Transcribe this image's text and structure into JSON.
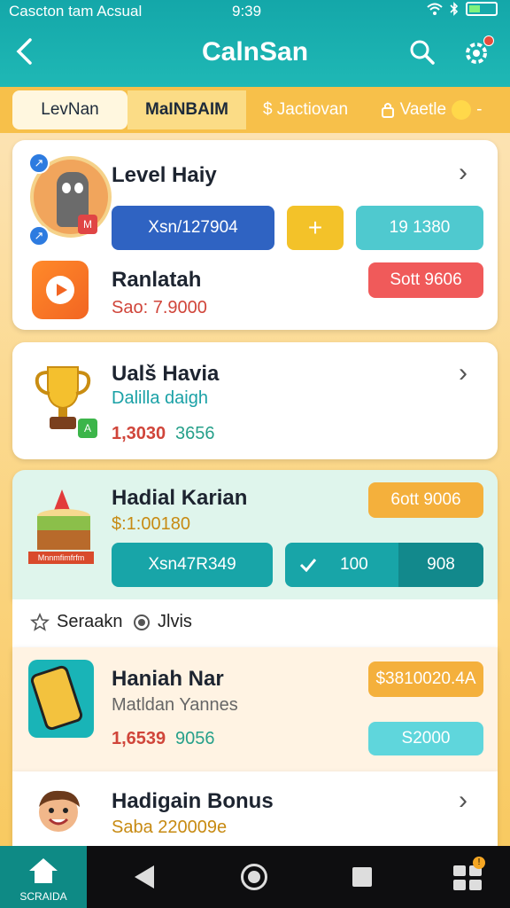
{
  "statusbar": {
    "carrier": "Cascton tam Acsual",
    "time": "9:39"
  },
  "appbar": {
    "title": "CalnSan"
  },
  "tabs": [
    "LevNan",
    "MaINBAIM",
    "$ Jactiovan",
    "Vaetle"
  ],
  "card1": {
    "title": "Level Haiy",
    "pill_left": "Xsn/127904",
    "pill_plus": "+",
    "pill_right": "19 1380",
    "sub_title": "Ranlatah",
    "sub_value": "Sao: 7.9000",
    "pill_red": "Sott 9606"
  },
  "card2": {
    "title": "Ualš Havia",
    "subtitle": "Dalilla daigh",
    "value_red": "1,3030",
    "value_green": "3656"
  },
  "card3": {
    "title": "Hadial Karian",
    "subtitle": "$:1:00180",
    "pill_orange": "6ott 9006",
    "pill_left": "Xsn47R349",
    "pill_mid": "100",
    "pill_right": "908",
    "cake_banner": "Mnnmfimfrfm"
  },
  "filterbar": {
    "item1": "Seraakn",
    "item2": "Jlvis"
  },
  "card4": {
    "title": "Haniah Nar",
    "subtitle": "Matldan Yannes",
    "value_red": "1,6539",
    "value_green": "9056",
    "pill_orange": "$3810020.4A",
    "pill_teal": "S2000"
  },
  "card5": {
    "title": "Hadigain Bonus",
    "subtitle": "Saba 220009e"
  },
  "navbar": {
    "home_label": "SCRAIDA"
  },
  "colors": {
    "teal": "#17abab",
    "blue": "#2f63c2",
    "yellow": "#f3c229",
    "red": "#f05a5a",
    "orange": "#f4b03c",
    "light_teal": "#5fd6dc"
  },
  "icons": [
    "back-icon",
    "search-icon",
    "gear-icon",
    "chevron-right-icon",
    "star-icon",
    "radio-icon",
    "check-icon",
    "home-icon"
  ]
}
